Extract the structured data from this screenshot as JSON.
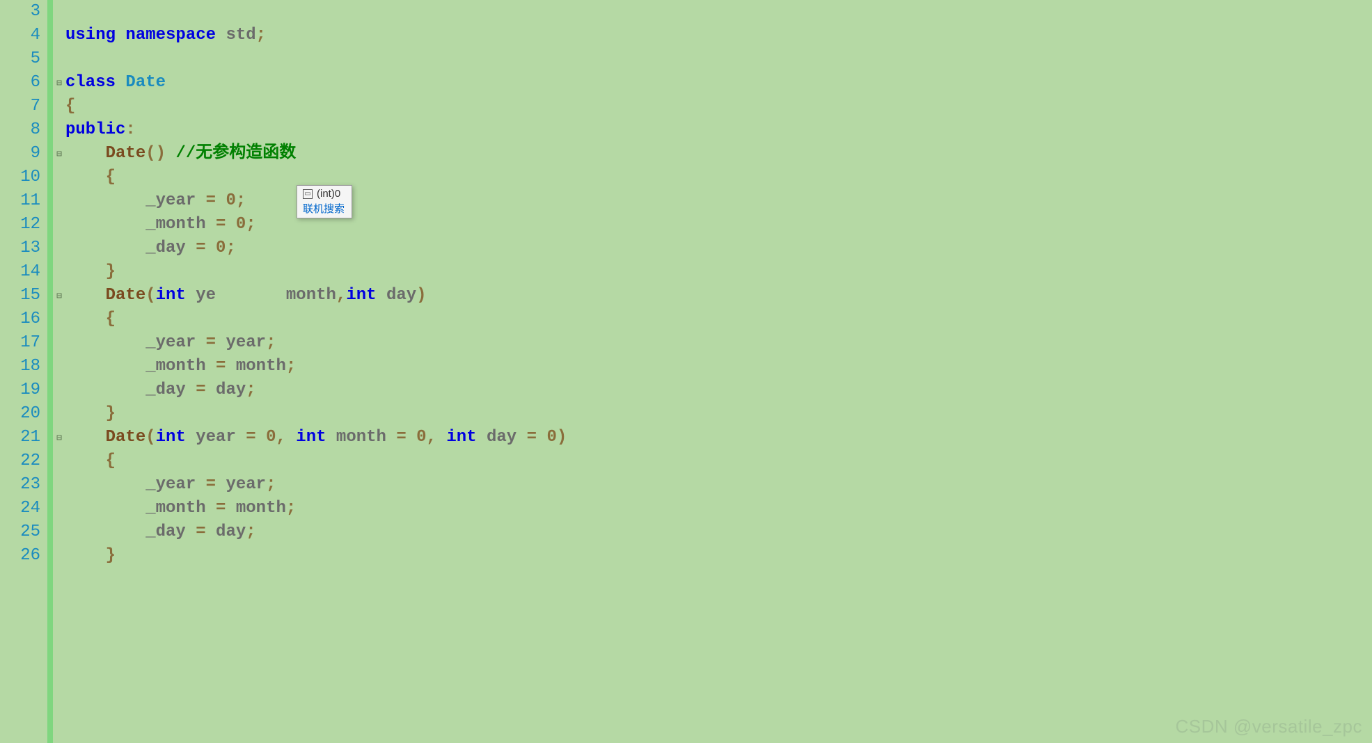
{
  "gutter": {
    "start": 3,
    "end": 26
  },
  "fold": {
    "classLine": 6,
    "ctor1Line": 9,
    "ctor2Line": 15,
    "ctor3Line": 21
  },
  "code": {
    "l3": "",
    "l4_using": "using",
    "l4_ns": "namespace",
    "l4_std": "std",
    "l5": "",
    "l6_class": "class",
    "l6_name": "Date",
    "l7_brace": "{",
    "l8_public": "public",
    "l9_fn": "Date",
    "l9_cmt": "//无参构造函数",
    "l10_brace": "{",
    "l11_m": "_year",
    "l11_v": "0",
    "l12_m": "_month",
    "l12_v": "0",
    "l13_m": "_day",
    "l13_v": "0",
    "l14_brace": "}",
    "l15_fn": "Date",
    "l15_int": "int",
    "l15_p1a": "ye",
    "l15_p2": "month",
    "l15_p3": "day",
    "l16_brace": "{",
    "l17_m": "_year",
    "l17_v": "year",
    "l18_m": "_month",
    "l18_v": "month",
    "l19_m": "_day",
    "l19_v": "day",
    "l20_brace": "}",
    "l21_fn": "Date",
    "l21_int": "int",
    "l21_p1": "year",
    "l21_d1": "0",
    "l21_p2": "month",
    "l21_d2": "0",
    "l21_p3": "day",
    "l21_d3": "0",
    "l22_brace": "{",
    "l23_m": "_year",
    "l23_v": "year",
    "l24_m": "_month",
    "l24_v": "month",
    "l25_m": "_day",
    "l25_v": "day",
    "l26_brace": "}"
  },
  "tooltip": {
    "type_hint": "(int)0",
    "search_link": "联机搜索"
  },
  "watermark": "CSDN @versatile_zpc"
}
